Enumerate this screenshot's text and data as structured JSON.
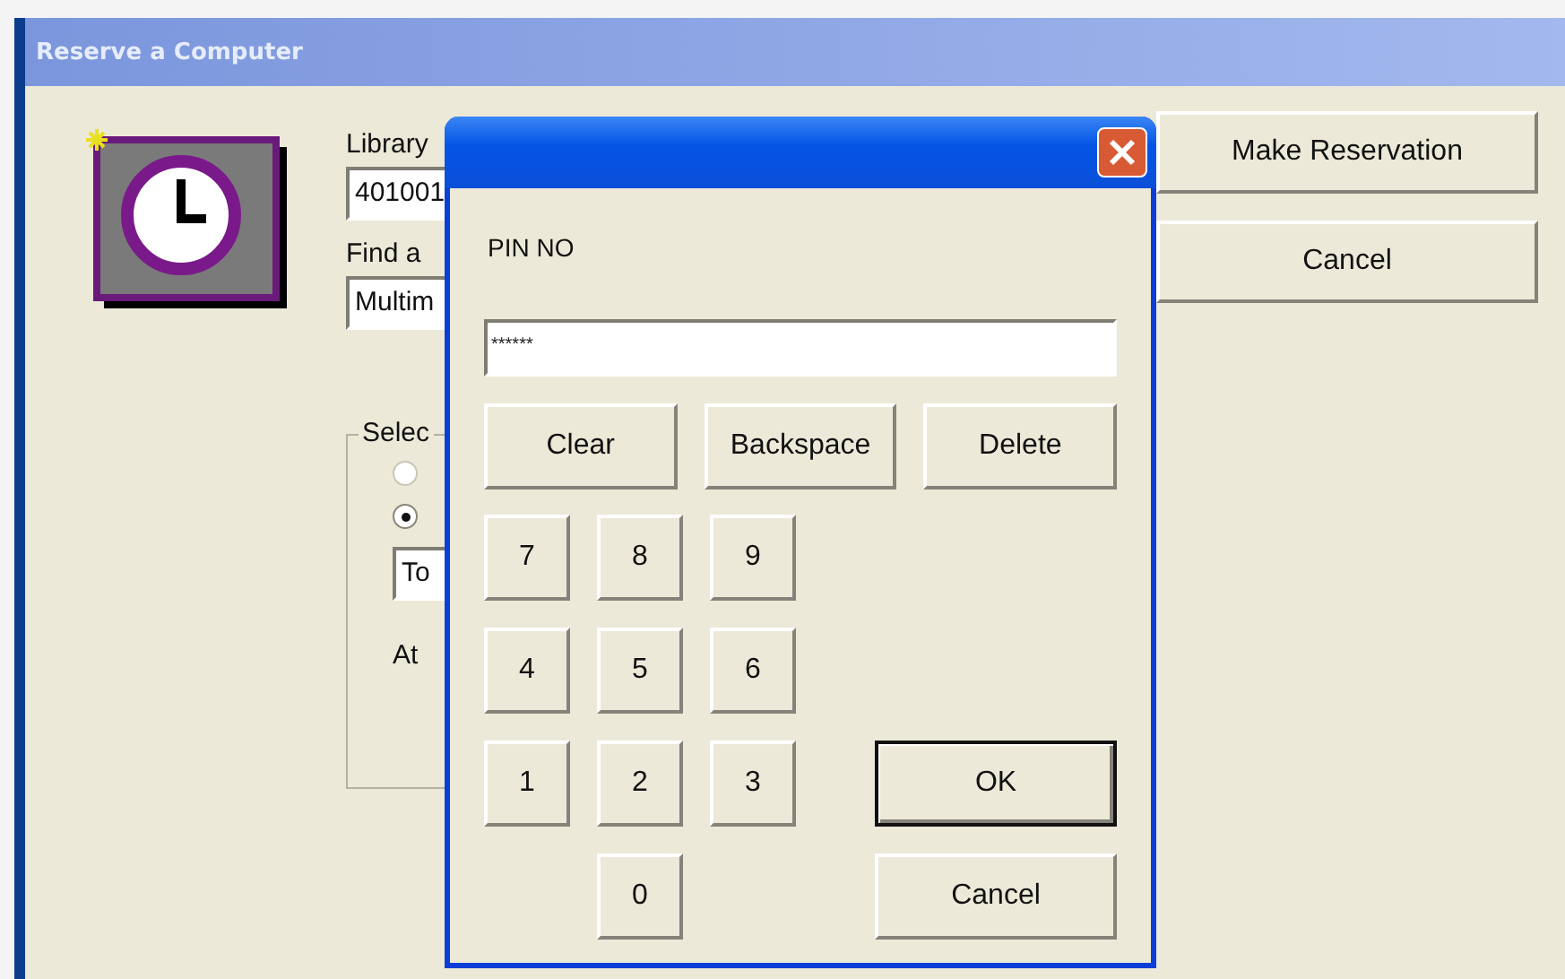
{
  "window": {
    "title": "Reserve a Computer"
  },
  "form": {
    "library_label": "Library",
    "library_value": "401001",
    "find_label": "Find a",
    "find_value": "Multim",
    "group": {
      "legend": "Selec",
      "radios": [
        {
          "selected": false,
          "disabled": true
        },
        {
          "selected": true,
          "disabled": false
        }
      ],
      "date_value": "To",
      "at_label": "At"
    }
  },
  "buttons": [
    {
      "label": "Make Reservation"
    },
    {
      "label": "Cancel"
    }
  ],
  "dialog": {
    "prompt": "PIN NO",
    "pin_value": "******",
    "edit_buttons": [
      "Clear",
      "Backspace",
      "Delete"
    ],
    "digits": [
      "7",
      "8",
      "9",
      "4",
      "5",
      "6",
      "1",
      "2",
      "3",
      "0"
    ],
    "actions": [
      {
        "label": "OK",
        "default": true
      },
      {
        "label": "Cancel",
        "default": false
      }
    ]
  }
}
